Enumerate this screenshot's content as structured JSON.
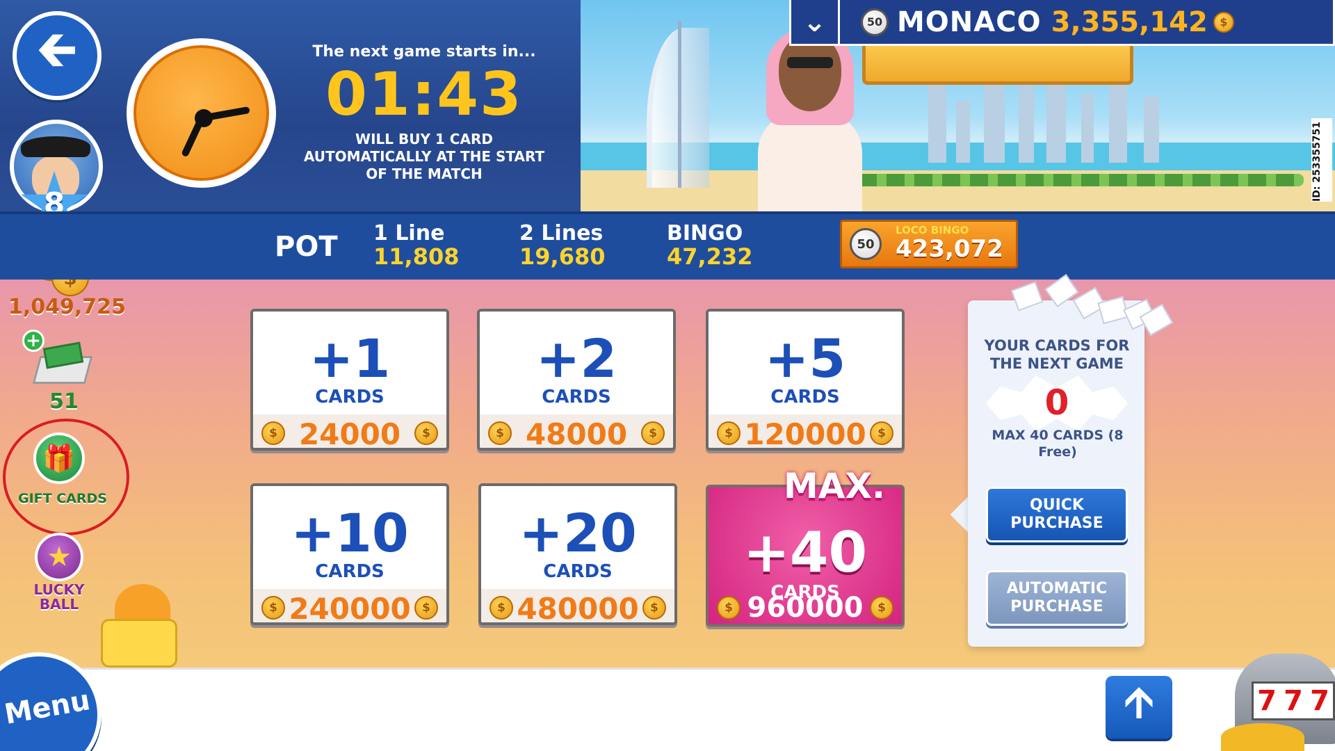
{
  "room": {
    "ball_count": "50",
    "name": "MONACO",
    "jackpot": "3,355,142"
  },
  "side_id": "ID: 253355751",
  "countdown": {
    "title": "The next game starts in...",
    "time": "01:43",
    "note": "WILL BUY 1 CARD AUTOMATICALLY AT THE START OF THE MATCH"
  },
  "player": {
    "level": "8",
    "coins": "1,049,725",
    "cards": "51"
  },
  "side_menu": {
    "gift_cards": "GIFT CARDS",
    "lucky_ball": "LUCKY BALL"
  },
  "pot": {
    "label": "POT",
    "line1_label": "1 Line",
    "line1_value": "11,808",
    "line2_label": "2 Lines",
    "line2_value": "19,680",
    "bingo_label": "BINGO",
    "bingo_value": "47,232",
    "loco_ball": "50",
    "loco_label": "LOCO BINGO",
    "loco_value": "423,072"
  },
  "packs": [
    {
      "count": "+1",
      "word": "CARDS",
      "price": "24000"
    },
    {
      "count": "+2",
      "word": "CARDS",
      "price": "48000"
    },
    {
      "count": "+5",
      "word": "CARDS",
      "price": "120000"
    },
    {
      "count": "+10",
      "word": "CARDS",
      "price": "240000"
    },
    {
      "count": "+20",
      "word": "CARDS",
      "price": "480000"
    },
    {
      "count": "+40",
      "word": "CARDS",
      "price": "960000",
      "badge": "MAX."
    }
  ],
  "next_cards": {
    "title": "YOUR CARDS FOR THE NEXT GAME",
    "count": "0",
    "max_note": "MAX 40 CARDS (8 Free)",
    "quick_purchase": "QUICK PURCHASE",
    "automatic_purchase": "AUTOMATIC PURCHASE"
  },
  "bottom": {
    "menu": "Menu"
  },
  "icons": {
    "back": "arrow-left-icon",
    "room": "chevron-down-icon",
    "coin": "coin-icon",
    "gift": "gift-icon",
    "lucky": "star-icon",
    "scroll_up": "arrow-up-icon"
  },
  "colors": {
    "primary_blue": "#1f62c4",
    "pot_bar": "#1f4d9e",
    "gold": "#ffc51c",
    "price_orange": "#f07b17",
    "max_pink": "#d4237f",
    "highlight_red": "#d91c24"
  }
}
